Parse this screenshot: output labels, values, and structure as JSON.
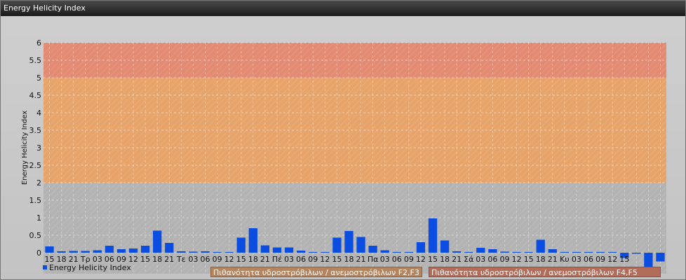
{
  "window": {
    "title": "Energy Helicity Index"
  },
  "legend": {
    "label": "Energy Helicity Index",
    "color": "#0a4de0"
  },
  "bands": [
    {
      "label": "Πιθανότητα υδροστρόβιλων / ανεμοστρόβιλων F2,F3",
      "from": 2,
      "to": 5,
      "color": "#e7a46a"
    },
    {
      "label": "Πιθανότητα υδροστρόβιλων / ανεμοστρόβιλων F4,F5",
      "from": 5,
      "to": 6,
      "color": "#e38a72"
    }
  ],
  "chart_data": {
    "type": "bar",
    "title": "",
    "xlabel": "",
    "ylabel": "Energy Helicity Index",
    "ylim": [
      -0.6,
      6
    ],
    "yticks": [
      0,
      0.5,
      1,
      1.5,
      2,
      2.5,
      3,
      3.5,
      4,
      4.5,
      5,
      5.5,
      6
    ],
    "grid": true,
    "categories": [
      "15",
      "18",
      "21",
      "Τρ",
      "03",
      "06",
      "09",
      "12",
      "15",
      "18",
      "21",
      "Τε",
      "03",
      "06",
      "09",
      "12",
      "15",
      "18",
      "21",
      "Πέ",
      "03",
      "06",
      "09",
      "12",
      "15",
      "18",
      "21",
      "Πα",
      "03",
      "06",
      "09",
      "12",
      "15",
      "18",
      "21",
      "Σά",
      "03",
      "06",
      "09",
      "12",
      "15",
      "18",
      "21",
      "Κυ",
      "03",
      "06",
      "09",
      "12",
      "15",
      "",
      "",
      ""
    ],
    "series": [
      {
        "values": [
          0.18,
          0.04,
          0.05,
          0.05,
          0.07,
          0.2,
          0.1,
          0.12,
          0.2,
          0.63,
          0.28,
          0.04,
          0.03,
          0.04,
          0.02,
          0.02,
          0.43,
          0.7,
          0.21,
          0.15,
          0.15,
          0.06,
          0.02,
          0.02,
          0.43,
          0.62,
          0.45,
          0.2,
          0.07,
          0.02,
          0.02,
          0.3,
          0.98,
          0.35,
          0.04,
          0.02,
          0.14,
          0.1,
          0.03,
          0.02,
          0.02,
          0.37,
          0.1,
          0.02,
          0.02,
          0.02,
          0.02,
          0.02,
          -0.15,
          -0.03,
          -0.6,
          -0.25
        ],
        "color": "#0a4de0"
      }
    ]
  }
}
